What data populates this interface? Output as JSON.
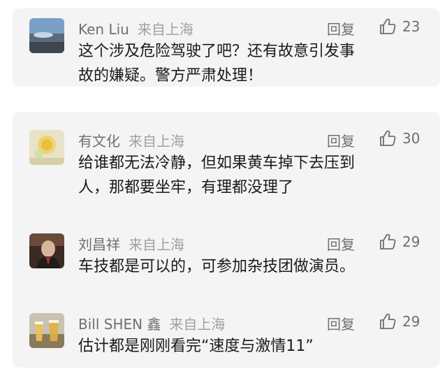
{
  "comments": [
    {
      "name": "Ken Liu",
      "location": "来自上海",
      "reply": "回复",
      "likes": "23",
      "lines": [
        "这个涉及危险驾驶了吧？还有故意引发事",
        "故的嫌疑。警方严肃处理！"
      ]
    },
    {
      "name": "有文化",
      "location": "来自上海",
      "reply": "回复",
      "likes": "30",
      "lines": [
        "给谁都无法冷静，但如果黄车掉下去压到",
        "人，那都要坐牢，有理都没理了"
      ]
    },
    {
      "name": "刘昌祥",
      "location": "来自上海",
      "reply": "回复",
      "likes": "29",
      "lines": [
        "车技都是可以的，可参加杂技团做演员。"
      ]
    },
    {
      "name": "Bill SHEN 鑫",
      "location": "来自上海",
      "reply": "回复",
      "likes": "29",
      "lines": [
        "估计都是刚刚看完“速度与激情11”"
      ]
    }
  ],
  "icons": {
    "like": "thumbs-up-icon"
  },
  "colors": {
    "card_bg": "#f4f4f4",
    "meta_text": "#6f6f6f",
    "location_text": "#a0a0a0",
    "body_text": "#1a1a1a"
  }
}
